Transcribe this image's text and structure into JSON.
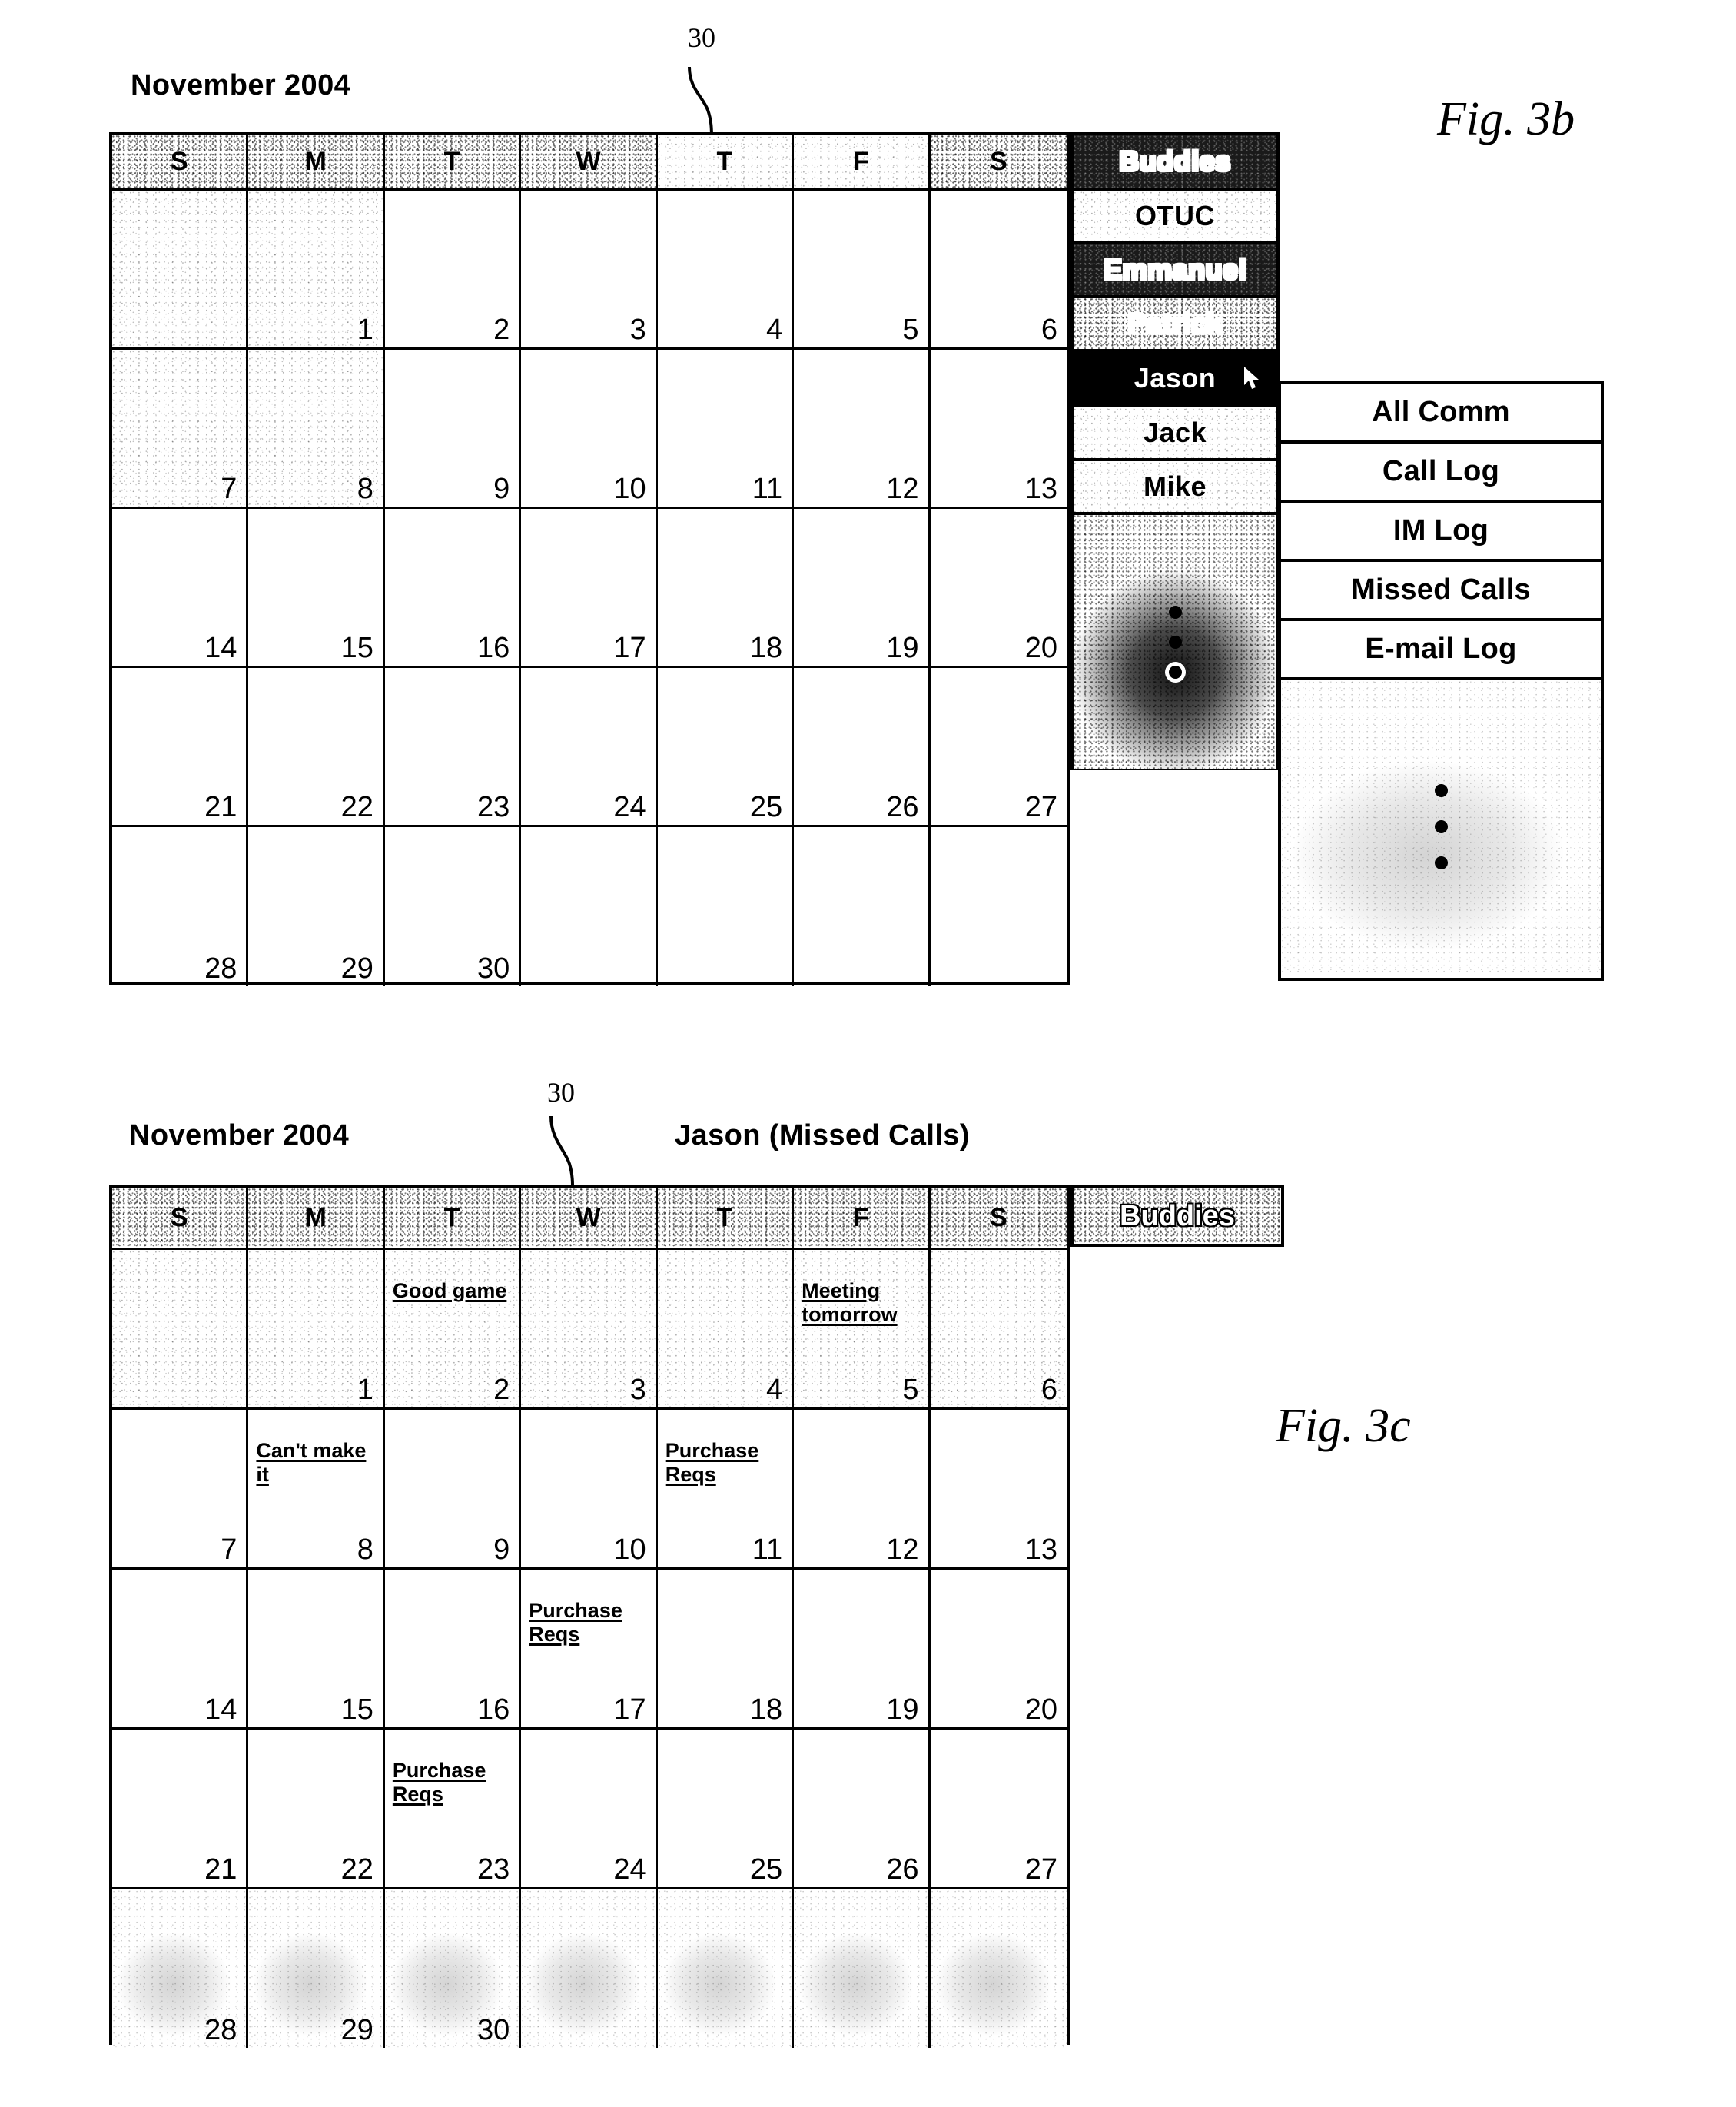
{
  "figures": [
    {
      "id": "fig3b",
      "label": "Fig. 3b",
      "reference_numeral": "30",
      "month_title": "November 2004",
      "day_headers": [
        "S",
        "M",
        "T",
        "W",
        "T",
        "F",
        "S"
      ],
      "weeks": [
        [
          null,
          "1",
          "2",
          "3",
          "4",
          "5",
          "6"
        ],
        [
          "7",
          "8",
          "9",
          "10",
          "11",
          "12",
          "13"
        ],
        [
          "14",
          "15",
          "16",
          "17",
          "18",
          "19",
          "20"
        ],
        [
          "21",
          "22",
          "23",
          "24",
          "25",
          "26",
          "27"
        ],
        [
          "28",
          "29",
          "30",
          null,
          null,
          null,
          null
        ]
      ],
      "buddies_panel": {
        "header": "Buddies",
        "items": [
          "OTUC",
          "Emmanuel",
          "Patrick",
          "Jason",
          "Jack",
          "Mike"
        ],
        "selected": "Jason",
        "overflow_indicator": "vertical-ellipsis",
        "cursor": "pointer-arrow"
      },
      "submenu": {
        "items": [
          "All Comm",
          "Call Log",
          "IM Log",
          "Missed Calls",
          "E-mail Log"
        ],
        "overflow_indicator": "vertical-ellipsis"
      }
    },
    {
      "id": "fig3c",
      "label": "Fig. 3c",
      "reference_numeral": "30",
      "month_title": "November 2004",
      "buddy_context_title": "Jason (Missed Calls)",
      "day_headers": [
        "S",
        "M",
        "T",
        "W",
        "T",
        "F",
        "S"
      ],
      "buddies_tab": "Buddies",
      "weeks": [
        [
          {
            "day": null,
            "event": null
          },
          {
            "day": "1",
            "event": null
          },
          {
            "day": "2",
            "event": "Good game"
          },
          {
            "day": "3",
            "event": null
          },
          {
            "day": "4",
            "event": null
          },
          {
            "day": "5",
            "event": "Meeting tomorrow"
          },
          {
            "day": "6",
            "event": null
          }
        ],
        [
          {
            "day": "7",
            "event": null
          },
          {
            "day": "8",
            "event": "Can't make it"
          },
          {
            "day": "9",
            "event": null
          },
          {
            "day": "10",
            "event": null
          },
          {
            "day": "11",
            "event": "Purchase Reqs"
          },
          {
            "day": "12",
            "event": null
          },
          {
            "day": "13",
            "event": null
          }
        ],
        [
          {
            "day": "14",
            "event": null
          },
          {
            "day": "15",
            "event": null
          },
          {
            "day": "16",
            "event": null
          },
          {
            "day": "17",
            "event": "Purchase Reqs"
          },
          {
            "day": "18",
            "event": null
          },
          {
            "day": "19",
            "event": null
          },
          {
            "day": "20",
            "event": null
          }
        ],
        [
          {
            "day": "21",
            "event": null
          },
          {
            "day": "22",
            "event": null
          },
          {
            "day": "23",
            "event": "Purchase Reqs"
          },
          {
            "day": "24",
            "event": null
          },
          {
            "day": "25",
            "event": null
          },
          {
            "day": "26",
            "event": null
          },
          {
            "day": "27",
            "event": null
          }
        ],
        [
          {
            "day": "28",
            "event": null
          },
          {
            "day": "29",
            "event": null
          },
          {
            "day": "30",
            "event": null
          },
          {
            "day": null,
            "event": null
          },
          {
            "day": null,
            "event": null
          },
          {
            "day": null,
            "event": null
          },
          {
            "day": null,
            "event": null
          }
        ]
      ]
    }
  ],
  "colors": {
    "ink": "#000000",
    "paper": "#ffffff",
    "highlight": "#000000"
  }
}
